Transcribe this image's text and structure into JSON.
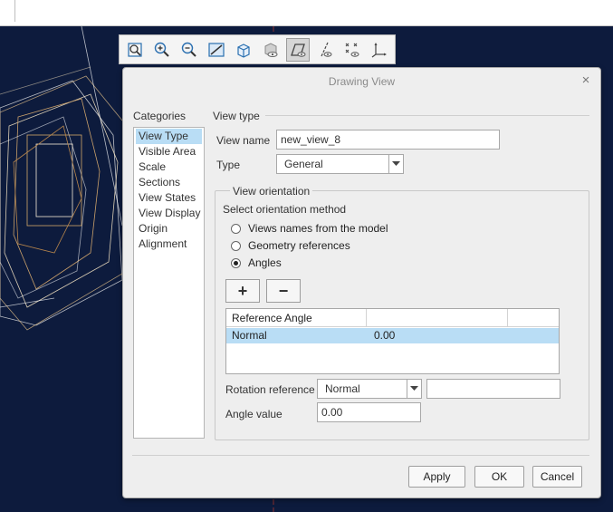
{
  "toolbar": {
    "icons": [
      "zoom-window-icon",
      "zoom-in-icon",
      "zoom-out-icon",
      "refit-icon",
      "display-style-icon",
      "saved-orientations-icon",
      "plane-display-icon",
      "axis-display-icon",
      "point-display-icon",
      "csys-display-icon"
    ]
  },
  "dialog": {
    "title": "Drawing View",
    "close": "×",
    "categories_label": "Categories",
    "categories": [
      "View Type",
      "Visible Area",
      "Scale",
      "Sections",
      "View States",
      "View Display",
      "Origin",
      "Alignment"
    ],
    "section_title": "View type",
    "view_name_label": "View name",
    "view_name_value": "new_view_8",
    "type_label": "Type",
    "type_value": "General",
    "orientation": {
      "title": "View orientation",
      "method_label": "Select orientation method",
      "options": [
        "Views names from the model",
        "Geometry references",
        "Angles"
      ],
      "selected": "Angles",
      "add_label": "+",
      "remove_label": "−",
      "table": {
        "headers": [
          "Reference Angle",
          "",
          ""
        ],
        "rows": [
          [
            "Normal",
            "0.00",
            ""
          ]
        ]
      },
      "rotation_reference_label": "Rotation reference",
      "rotation_reference_value": "Normal",
      "rotation_reference_extra": "",
      "angle_value_label": "Angle value",
      "angle_value": "0.00"
    },
    "buttons": {
      "apply": "Apply",
      "ok": "OK",
      "cancel": "Cancel"
    }
  }
}
